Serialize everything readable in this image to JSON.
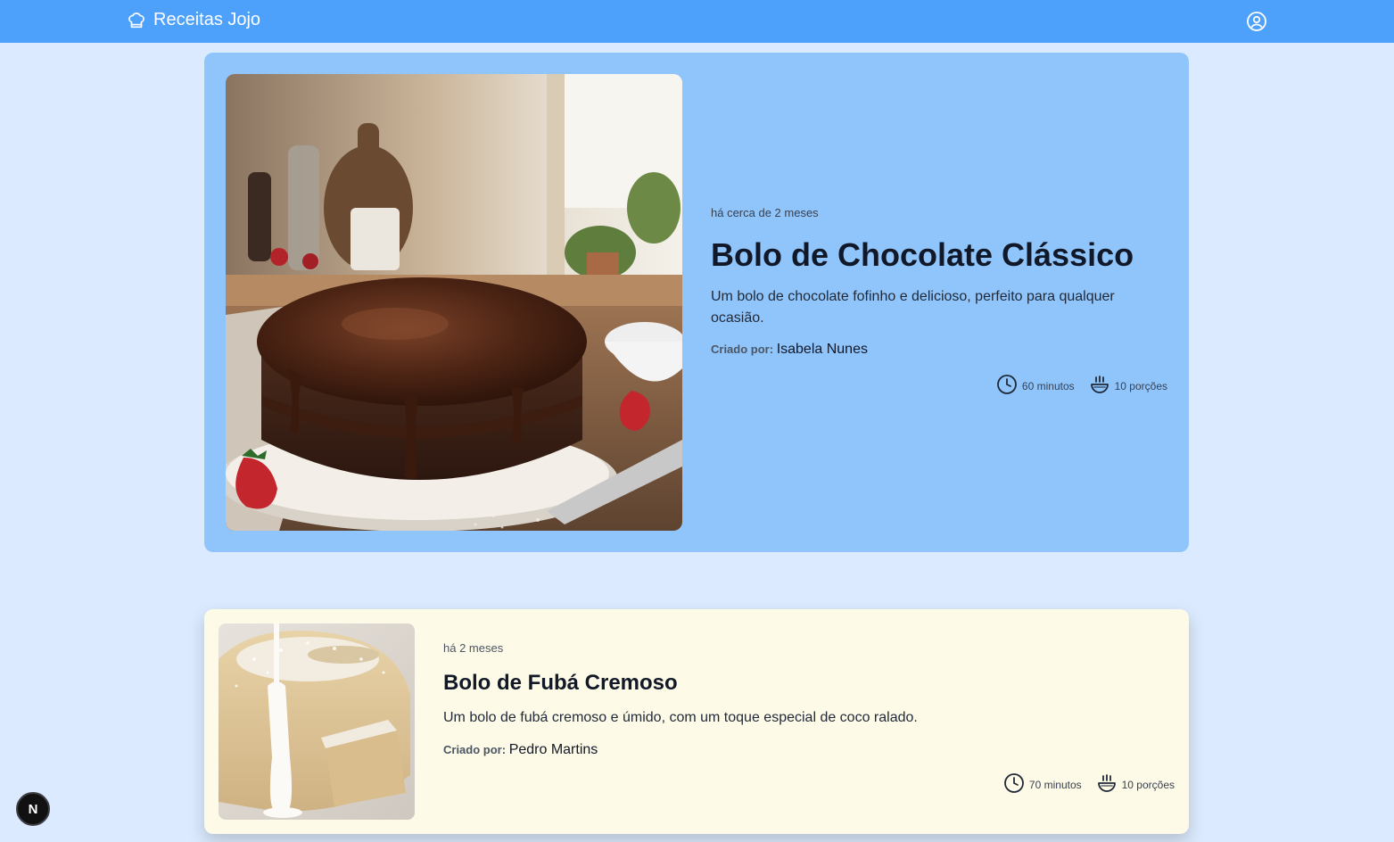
{
  "header": {
    "brand": "Receitas Jojo",
    "accent": "#4ea1fb"
  },
  "featured": {
    "date": "há cerca de 2 meses",
    "title": "Bolo de Chocolate Clássico",
    "description": "Um bolo de chocolate fofinho e delicioso, perfeito para qualquer ocasião.",
    "author_label": "Criado por:",
    "author": "Isabela Nunes",
    "time": "60 minutos",
    "servings": "10 porções",
    "image": "chocolate-cake-photo",
    "image_badge": "ai",
    "bg": "#90c5fc"
  },
  "recipes": [
    {
      "date": "há 2 meses",
      "title": "Bolo de Fubá Cremoso",
      "description": "Um bolo de fubá cremoso e úmido, com um toque especial de coco ralado.",
      "author_label": "Criado por:",
      "author": "Pedro Martins",
      "time": "70 minutos",
      "servings": "10 porções",
      "image": "cornmeal-cake-photo",
      "bg": "#fefae8"
    }
  ],
  "badge": {
    "label": "N"
  },
  "icons": [
    "chef-hat-icon",
    "user-circle-icon",
    "clock-icon",
    "bowl-icon"
  ]
}
